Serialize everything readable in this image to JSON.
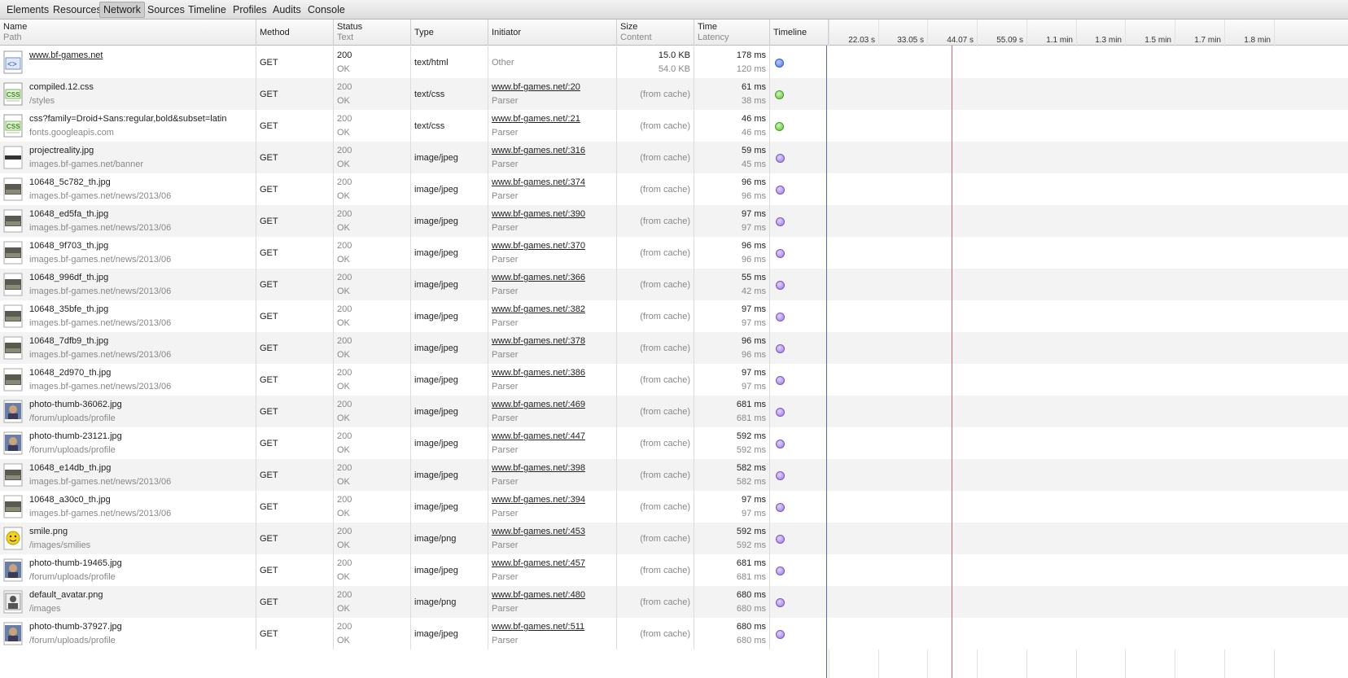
{
  "toolbar": {
    "tabs": [
      "Elements",
      "Resources",
      "Network",
      "Sources",
      "Timeline",
      "Profiles",
      "Audits",
      "Console"
    ],
    "active": "Network"
  },
  "columns": {
    "name": {
      "title": "Name",
      "sub": "Path"
    },
    "method": {
      "title": "Method"
    },
    "status": {
      "title": "Status",
      "sub": "Text"
    },
    "type": {
      "title": "Type"
    },
    "initiator": {
      "title": "Initiator"
    },
    "size": {
      "title": "Size",
      "sub": "Content"
    },
    "time": {
      "title": "Time",
      "sub": "Latency"
    },
    "timeline": {
      "title": "Timeline"
    }
  },
  "timeline_ticks": [
    "22.03 s",
    "33.05 s",
    "44.07 s",
    "55.09 s",
    "1.1 min",
    "1.3 min",
    "1.5 min",
    "1.7 min",
    "1.8 min"
  ],
  "requests": [
    {
      "name": "www.bf-games.net",
      "path": "",
      "name_link": true,
      "icon": "html-file-icon",
      "method": "GET",
      "status": "200",
      "status_text": "OK",
      "type": "text/html",
      "initiator": "Other",
      "initiator_sub": "",
      "size": "15.0 KB",
      "content": "54.0 KB",
      "time": "178 ms",
      "latency": "120 ms",
      "kind": "html"
    },
    {
      "name": "compiled.12.css",
      "path": "/styles",
      "icon": "css-file-icon",
      "method": "GET",
      "status": "200",
      "status_text": "OK",
      "type": "text/css",
      "initiator": "www.bf-games.net/:20",
      "initiator_sub": "Parser",
      "size": "(from cache)",
      "content": "",
      "time": "61 ms",
      "latency": "38 ms",
      "kind": "css"
    },
    {
      "name": "css?family=Droid+Sans:regular,bold&subset=latin",
      "path": "fonts.googleapis.com",
      "icon": "css-file-icon",
      "method": "GET",
      "status": "200",
      "status_text": "OK",
      "type": "text/css",
      "initiator": "www.bf-games.net/:21",
      "initiator_sub": "Parser",
      "size": "(from cache)",
      "content": "",
      "time": "46 ms",
      "latency": "46 ms",
      "kind": "css"
    },
    {
      "name": "projectreality.jpg",
      "path": "images.bf-games.net/banner",
      "icon": "banner-thumbnail-icon",
      "method": "GET",
      "status": "200",
      "status_text": "OK",
      "type": "image/jpeg",
      "initiator": "www.bf-games.net/:316",
      "initiator_sub": "Parser",
      "size": "(from cache)",
      "content": "",
      "time": "59 ms",
      "latency": "45 ms",
      "kind": "img"
    },
    {
      "name": "10648_5c782_th.jpg",
      "path": "images.bf-games.net/news/2013/06",
      "icon": "photo-thumbnail-icon",
      "method": "GET",
      "status": "200",
      "status_text": "OK",
      "type": "image/jpeg",
      "initiator": "www.bf-games.net/:374",
      "initiator_sub": "Parser",
      "size": "(from cache)",
      "content": "",
      "time": "96 ms",
      "latency": "96 ms",
      "kind": "img"
    },
    {
      "name": "10648_ed5fa_th.jpg",
      "path": "images.bf-games.net/news/2013/06",
      "icon": "photo-thumbnail-icon",
      "method": "GET",
      "status": "200",
      "status_text": "OK",
      "type": "image/jpeg",
      "initiator": "www.bf-games.net/:390",
      "initiator_sub": "Parser",
      "size": "(from cache)",
      "content": "",
      "time": "97 ms",
      "latency": "97 ms",
      "kind": "img"
    },
    {
      "name": "10648_9f703_th.jpg",
      "path": "images.bf-games.net/news/2013/06",
      "icon": "photo-thumbnail-icon",
      "method": "GET",
      "status": "200",
      "status_text": "OK",
      "type": "image/jpeg",
      "initiator": "www.bf-games.net/:370",
      "initiator_sub": "Parser",
      "size": "(from cache)",
      "content": "",
      "time": "96 ms",
      "latency": "96 ms",
      "kind": "img"
    },
    {
      "name": "10648_996df_th.jpg",
      "path": "images.bf-games.net/news/2013/06",
      "icon": "photo-thumbnail-icon",
      "method": "GET",
      "status": "200",
      "status_text": "OK",
      "type": "image/jpeg",
      "initiator": "www.bf-games.net/:366",
      "initiator_sub": "Parser",
      "size": "(from cache)",
      "content": "",
      "time": "55 ms",
      "latency": "42 ms",
      "kind": "img"
    },
    {
      "name": "10648_35bfe_th.jpg",
      "path": "images.bf-games.net/news/2013/06",
      "icon": "photo-thumbnail-icon",
      "method": "GET",
      "status": "200",
      "status_text": "OK",
      "type": "image/jpeg",
      "initiator": "www.bf-games.net/:382",
      "initiator_sub": "Parser",
      "size": "(from cache)",
      "content": "",
      "time": "97 ms",
      "latency": "97 ms",
      "kind": "img"
    },
    {
      "name": "10648_7dfb9_th.jpg",
      "path": "images.bf-games.net/news/2013/06",
      "icon": "photo-thumbnail-icon",
      "method": "GET",
      "status": "200",
      "status_text": "OK",
      "type": "image/jpeg",
      "initiator": "www.bf-games.net/:378",
      "initiator_sub": "Parser",
      "size": "(from cache)",
      "content": "",
      "time": "96 ms",
      "latency": "96 ms",
      "kind": "img"
    },
    {
      "name": "10648_2d970_th.jpg",
      "path": "images.bf-games.net/news/2013/06",
      "icon": "photo-thumbnail-icon",
      "method": "GET",
      "status": "200",
      "status_text": "OK",
      "type": "image/jpeg",
      "initiator": "www.bf-games.net/:386",
      "initiator_sub": "Parser",
      "size": "(from cache)",
      "content": "",
      "time": "97 ms",
      "latency": "97 ms",
      "kind": "img"
    },
    {
      "name": "photo-thumb-36062.jpg",
      "path": "/forum/uploads/profile",
      "icon": "profile-photo-icon",
      "method": "GET",
      "status": "200",
      "status_text": "OK",
      "type": "image/jpeg",
      "initiator": "www.bf-games.net/:469",
      "initiator_sub": "Parser",
      "size": "(from cache)",
      "content": "",
      "time": "681 ms",
      "latency": "681 ms",
      "kind": "img"
    },
    {
      "name": "photo-thumb-23121.jpg",
      "path": "/forum/uploads/profile",
      "icon": "profile-photo-icon",
      "method": "GET",
      "status": "200",
      "status_text": "OK",
      "type": "image/jpeg",
      "initiator": "www.bf-games.net/:447",
      "initiator_sub": "Parser",
      "size": "(from cache)",
      "content": "",
      "time": "592 ms",
      "latency": "592 ms",
      "kind": "img"
    },
    {
      "name": "10648_e14db_th.jpg",
      "path": "images.bf-games.net/news/2013/06",
      "icon": "photo-thumbnail-icon",
      "method": "GET",
      "status": "200",
      "status_text": "OK",
      "type": "image/jpeg",
      "initiator": "www.bf-games.net/:398",
      "initiator_sub": "Parser",
      "size": "(from cache)",
      "content": "",
      "time": "582 ms",
      "latency": "582 ms",
      "kind": "img"
    },
    {
      "name": "10648_a30c0_th.jpg",
      "path": "images.bf-games.net/news/2013/06",
      "icon": "photo-thumbnail-icon",
      "method": "GET",
      "status": "200",
      "status_text": "OK",
      "type": "image/jpeg",
      "initiator": "www.bf-games.net/:394",
      "initiator_sub": "Parser",
      "size": "(from cache)",
      "content": "",
      "time": "97 ms",
      "latency": "97 ms",
      "kind": "img"
    },
    {
      "name": "smile.png",
      "path": "/images/smilies",
      "icon": "smiley-icon",
      "method": "GET",
      "status": "200",
      "status_text": "OK",
      "type": "image/png",
      "initiator": "www.bf-games.net/:453",
      "initiator_sub": "Parser",
      "size": "(from cache)",
      "content": "",
      "time": "592 ms",
      "latency": "592 ms",
      "kind": "img"
    },
    {
      "name": "photo-thumb-19465.jpg",
      "path": "/forum/uploads/profile",
      "icon": "profile-photo-icon",
      "method": "GET",
      "status": "200",
      "status_text": "OK",
      "type": "image/jpeg",
      "initiator": "www.bf-games.net/:457",
      "initiator_sub": "Parser",
      "size": "(from cache)",
      "content": "",
      "time": "681 ms",
      "latency": "681 ms",
      "kind": "img"
    },
    {
      "name": "default_avatar.png",
      "path": "/images",
      "icon": "default-avatar-icon",
      "method": "GET",
      "status": "200",
      "status_text": "OK",
      "type": "image/png",
      "initiator": "www.bf-games.net/:480",
      "initiator_sub": "Parser",
      "size": "(from cache)",
      "content": "",
      "time": "680 ms",
      "latency": "680 ms",
      "kind": "img"
    },
    {
      "name": "photo-thumb-37927.jpg",
      "path": "/forum/uploads/profile",
      "icon": "profile-photo-icon",
      "method": "GET",
      "status": "200",
      "status_text": "OK",
      "type": "image/jpeg",
      "initiator": "www.bf-games.net/:511",
      "initiator_sub": "Parser",
      "size": "(from cache)",
      "content": "",
      "time": "680 ms",
      "latency": "680 ms",
      "kind": "img"
    }
  ]
}
